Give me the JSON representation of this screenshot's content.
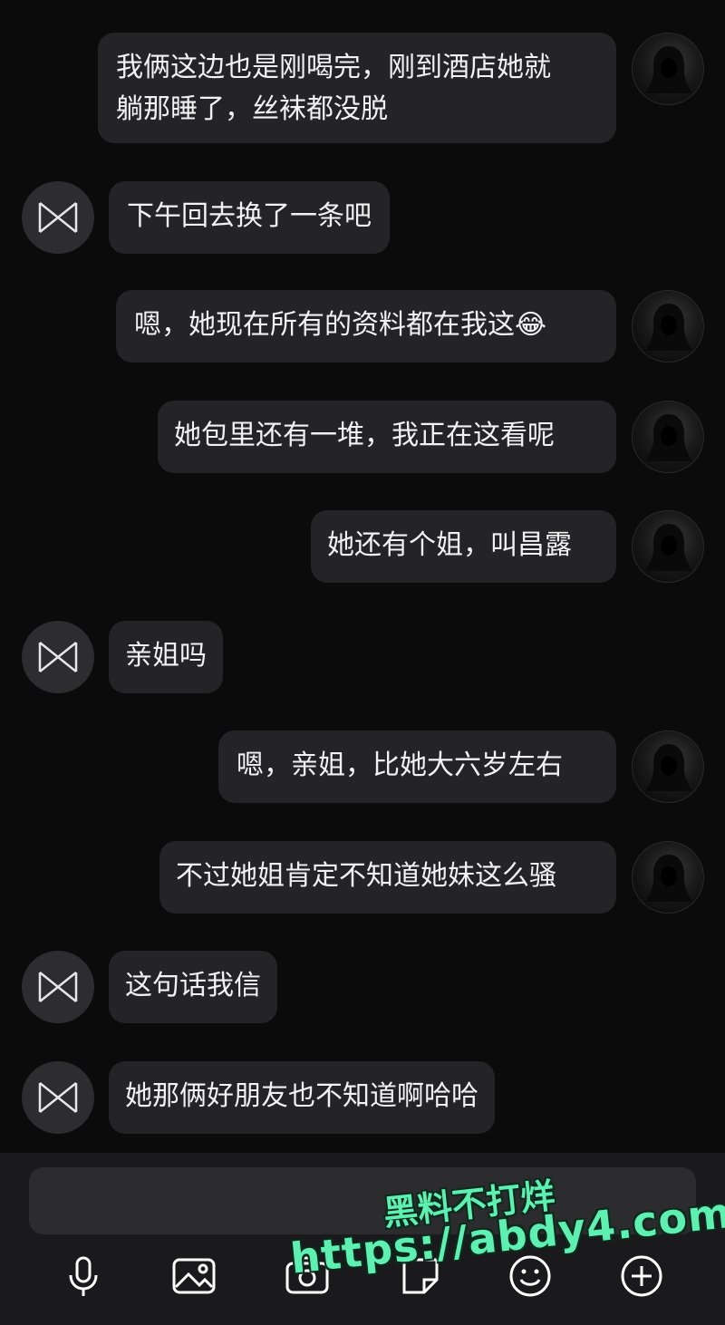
{
  "messages": [
    {
      "side": "self",
      "text": "我俩这边也是刚喝完，刚到酒店她就躺那睡了，丝袜都没脱"
    },
    {
      "side": "other",
      "text": "下午回去换了一条吧"
    },
    {
      "side": "self",
      "text": "嗯，她现在所有的资料都在我这",
      "emoji": "😂"
    },
    {
      "side": "self",
      "text": "她包里还有一堆，我正在这看呢"
    },
    {
      "side": "self",
      "text": "她还有个姐，叫昌露"
    },
    {
      "side": "other",
      "text": "亲姐吗"
    },
    {
      "side": "self",
      "text": "嗯，亲姐，比她大六岁左右"
    },
    {
      "side": "self",
      "text": "不过她姐肯定不知道她妹这么骚"
    },
    {
      "side": "other",
      "text": "这句话我信"
    },
    {
      "side": "other",
      "text": "她那俩好朋友也不知道啊哈哈"
    }
  ],
  "msg0_line1": "我俩这边也是刚喝完，刚到酒店她就",
  "msg0_line2": "躺那睡了，丝袜都没脱",
  "toolbar": {
    "icons": [
      "microphone-icon",
      "image-icon",
      "camera-icon",
      "sticker-icon",
      "emoji-icon",
      "plus-icon"
    ]
  },
  "watermark": {
    "line1": "黑料不打烊",
    "line2": "https://abdy4.com"
  },
  "colors": {
    "background": "#0b0b0c",
    "bubble": "#242426",
    "composer": "#1a1a1c",
    "watermark": "#5ef0b0"
  }
}
